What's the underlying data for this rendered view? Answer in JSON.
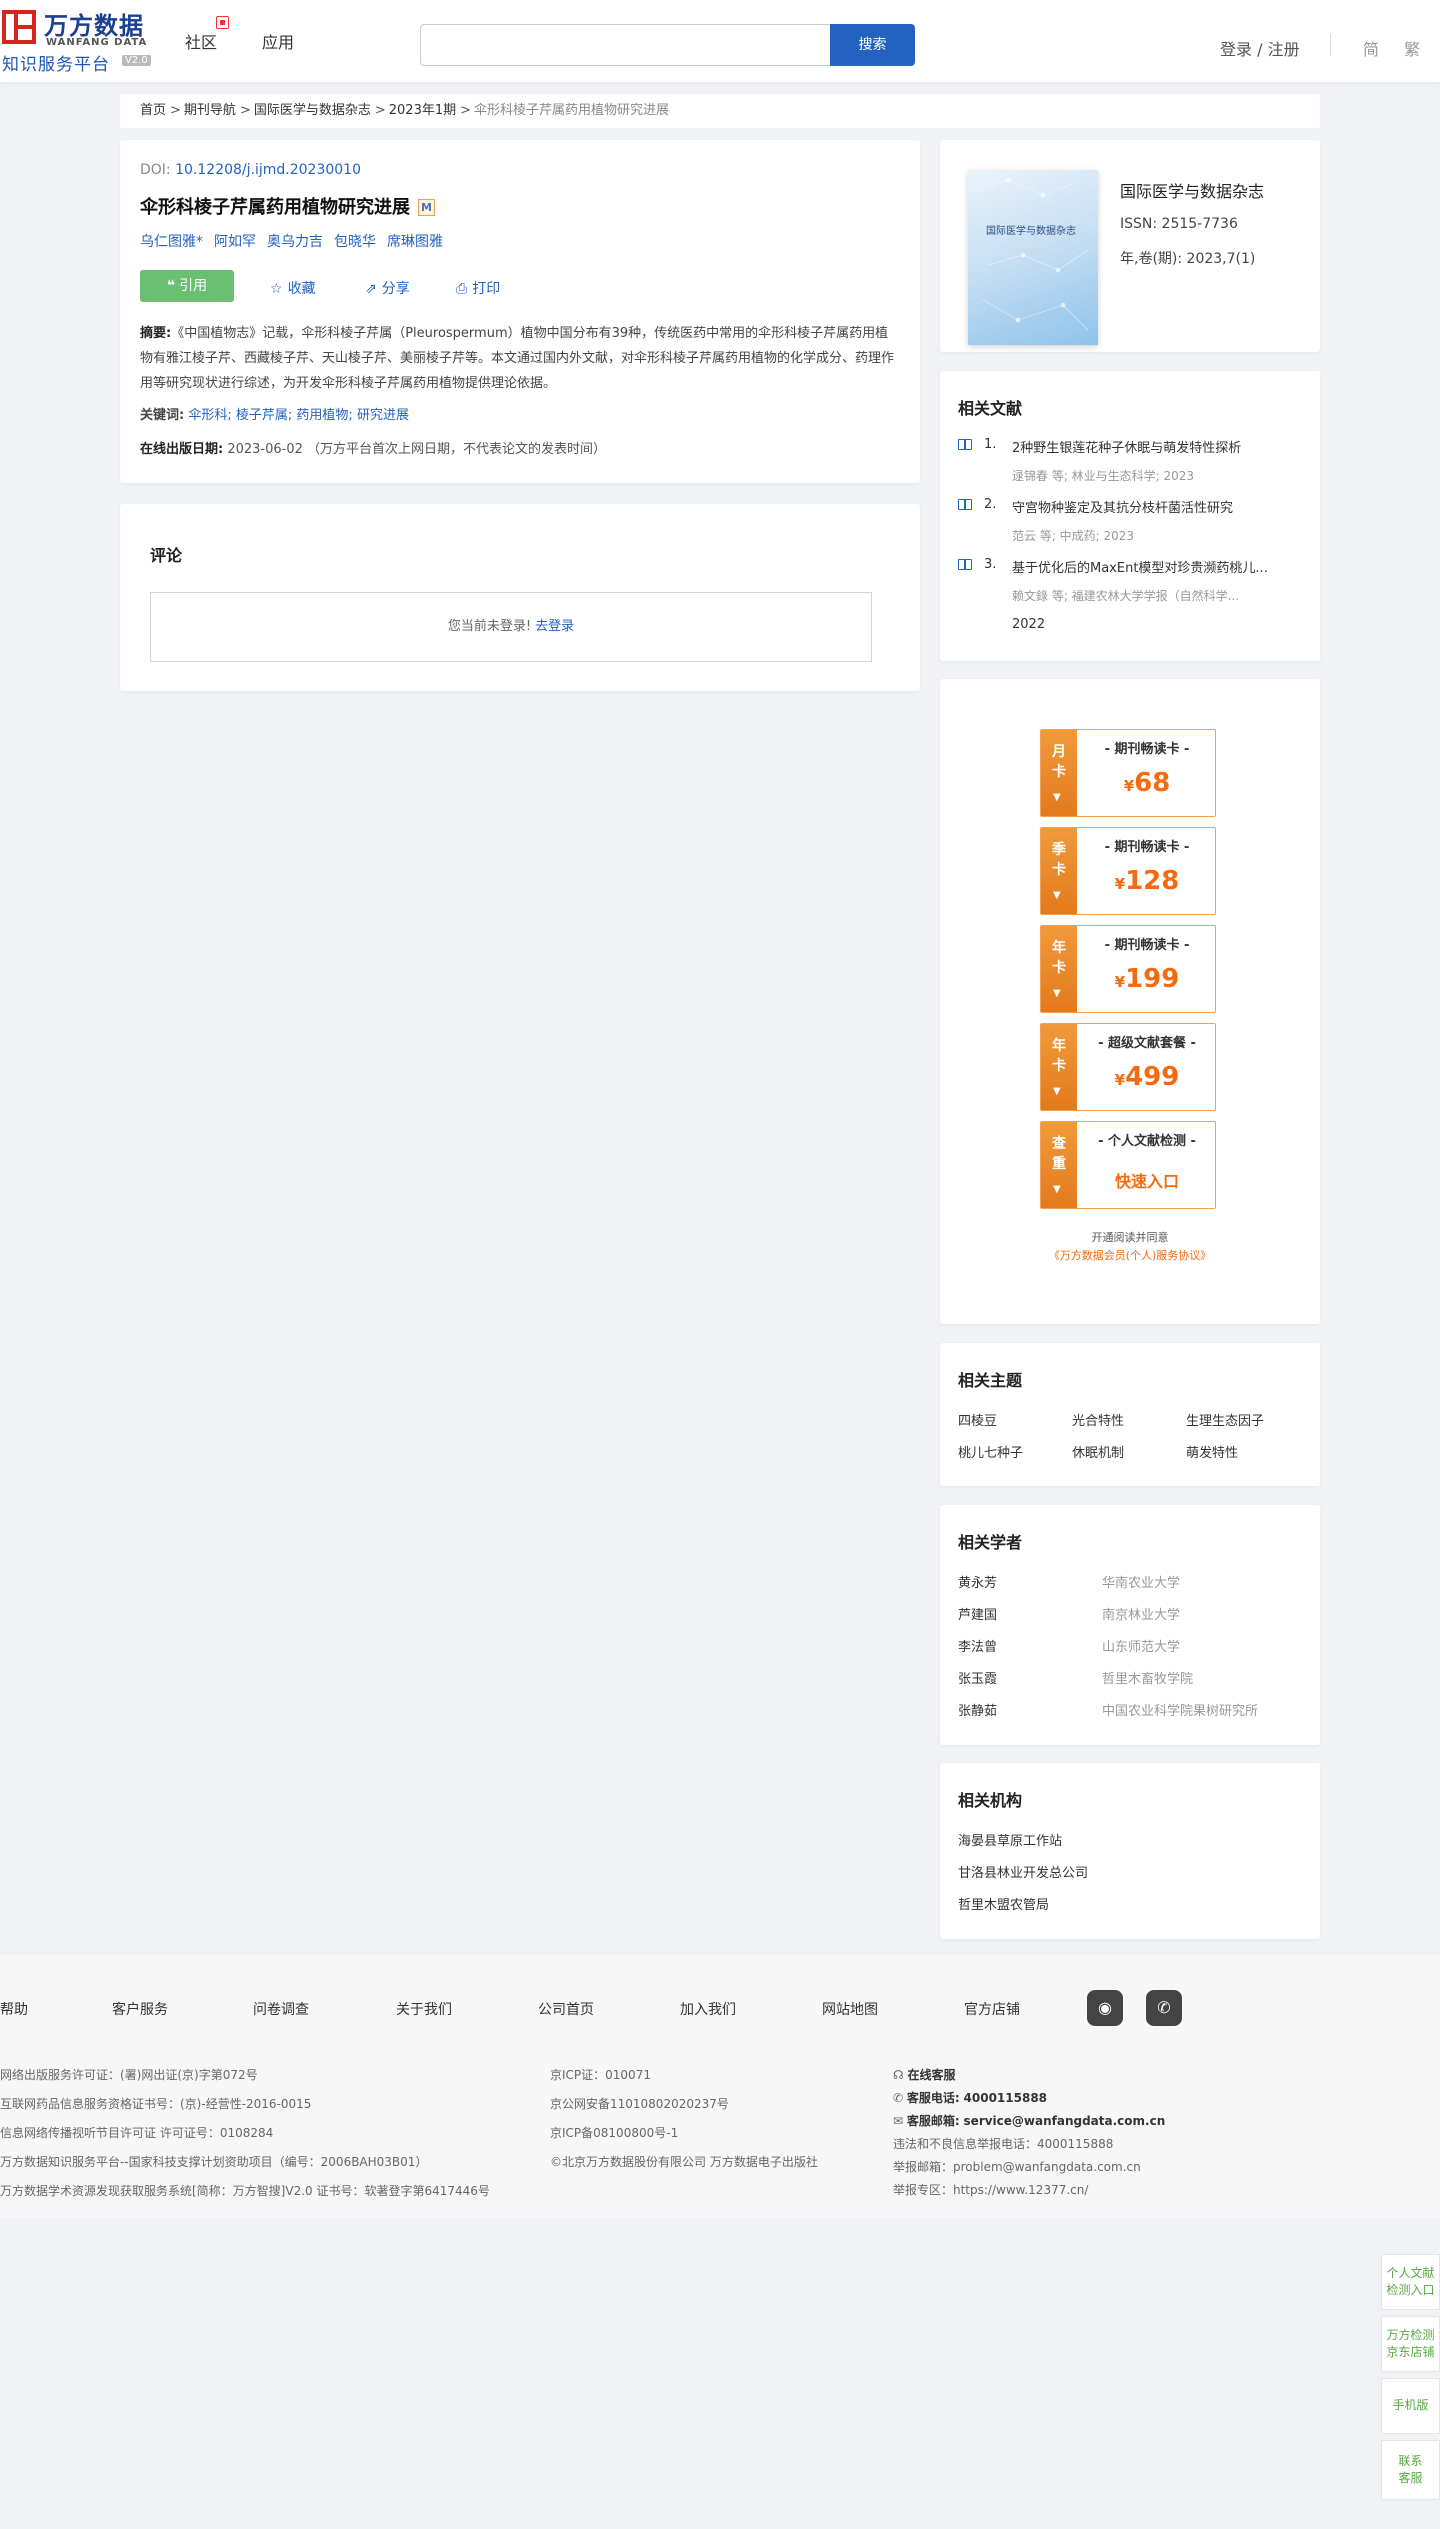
{
  "header": {
    "logo_cn": "万方数据",
    "logo_en": "WANFANG DATA",
    "logo_sub": "知识服务平台",
    "logo_ver": "V2.0",
    "nav": [
      "社区",
      "应用"
    ],
    "search_placeholder": "",
    "search_btn": "搜索",
    "login": "登录 / 注册",
    "lang_simplified": "简",
    "lang_traditional": "繁"
  },
  "breadcrumb": [
    "首页",
    "期刊导航",
    "国际医学与数据杂志",
    "2023年1期",
    "伞形科棱子芹属药用植物研究进展"
  ],
  "article": {
    "doi_label": "DOI:",
    "doi": "10.12208/j.ijmd.20230010",
    "title": "伞形科棱子芹属药用植物研究进展",
    "m_badge": "M",
    "authors": [
      "乌仁图雅*",
      "阿如罕",
      "奥乌力吉",
      "包晓华",
      "席琳图雅"
    ],
    "cite": "引用",
    "actions": [
      {
        "icon": "☆",
        "label": "收藏"
      },
      {
        "icon": "⇗",
        "label": "分享"
      },
      {
        "icon": "⎙",
        "label": "打印"
      }
    ],
    "abstract_label": "摘要:",
    "abstract": "《中国植物志》记载，伞形科棱子芹属（Pleurospermum）植物中国分布有39种，传统医药中常用的伞形科棱子芹属药用植物有雅江棱子芹、西藏棱子芹、天山棱子芹、美丽棱子芹等。本文通过国内外文献，对伞形科棱子芹属药用植物的化学成分、药理作用等研究现状进行综述，为开发伞形科棱子芹属药用植物提供理论依据。",
    "keywords_label": "关键词:",
    "keywords": [
      "伞形科;",
      "棱子芹属;",
      "药用植物;",
      "研究进展"
    ],
    "pubdate_label": "在线出版日期:",
    "pubdate": "2023-06-02",
    "pubdate_note": "（万方平台首次上网日期，不代表论文的发表时间）"
  },
  "comments": {
    "title": "评论",
    "not_logged": "您当前未登录!",
    "go_login": "去登录"
  },
  "journal": {
    "cover_text": "国际医学与数据杂志",
    "name": "国际医学与数据杂志",
    "issn": "ISSN:  2515-7736",
    "year_vol": "年,卷(期):  2023,7(1)"
  },
  "related_docs": {
    "title": "相关文献",
    "items": [
      {
        "num": "1.",
        "title": "2种野生银莲花种子休眠与萌发特性探析",
        "meta": "逯锦春  等;  林业与生态科学;  2023",
        "year": ""
      },
      {
        "num": "2.",
        "title": "守宫物种鉴定及其抗分枝杆菌活性研究",
        "meta": "范云  等;  中成药;  2023",
        "year": ""
      },
      {
        "num": "3.",
        "title": "基于优化后的MaxEnt模型对珍贵濒药桃儿...",
        "meta": "赖文錄  等;  福建农林大学学报（自然科学...",
        "year": "2022"
      }
    ]
  },
  "promo": {
    "cards": [
      {
        "side": [
          "月",
          "卡"
        ],
        "head": "- 期刊畅读卡 -",
        "currency": "¥",
        "price": "68"
      },
      {
        "side": [
          "季",
          "卡"
        ],
        "head": "- 期刊畅读卡 -",
        "currency": "¥",
        "price": "128"
      },
      {
        "side": [
          "年",
          "卡"
        ],
        "head": "- 期刊畅读卡 -",
        "currency": "¥",
        "price": "199"
      },
      {
        "side": [
          "年",
          "卡"
        ],
        "head": "- 超级文献套餐 -",
        "currency": "¥",
        "price": "499"
      },
      {
        "side": [
          "查",
          "重"
        ],
        "head": "- 个人文献检测 -",
        "quick": "快速入口"
      }
    ],
    "note1": "开通阅读并同意",
    "note2": "《万方数据会员(个人)服务协议》"
  },
  "topics": {
    "title": "相关主题",
    "items": [
      "四棱豆",
      "光合特性",
      "生理生态因子",
      "桃儿七种子",
      "休眠机制",
      "萌发特性"
    ]
  },
  "scholars": {
    "title": "相关学者",
    "items": [
      {
        "name": "黄永芳",
        "aff": "华南农业大学"
      },
      {
        "name": "芦建国",
        "aff": "南京林业大学"
      },
      {
        "name": "李法曾",
        "aff": "山东师范大学"
      },
      {
        "name": "张玉霞",
        "aff": "哲里木畜牧学院"
      },
      {
        "name": "张静茹",
        "aff": "中国农业科学院果树研究所"
      }
    ]
  },
  "orgs": {
    "title": "相关机构",
    "items": [
      "海晏县草原工作站",
      "甘洛县林业开发总公司",
      "哲里木盟农管局"
    ]
  },
  "footer": {
    "nav": [
      "帮助",
      "客户服务",
      "问卷调查",
      "关于我们",
      "公司首页",
      "加入我们",
      "网站地图",
      "官方店铺"
    ],
    "col1": [
      "网络出版服务许可证：(署)网出证(京)字第072号",
      "互联网药品信息服务资格证书号：(京)-经营性-2016-0015",
      "信息网络传播视听节目许可证 许可证号：0108284",
      "万方数据知识服务平台--国家科技支撑计划资助项目（编号：2006BAH03B01）",
      "万方数据学术资源发现获取服务系统[简称：万方智搜]V2.0 证书号：软著登字第6417446号"
    ],
    "col2": [
      "京ICP证：010071",
      "京公网安备11010802020237号",
      "京ICP备08100800号-1",
      "©北京万方数据股份有限公司 万方数据电子出版社"
    ],
    "online_service": "在线客服",
    "phone_label": "客服电话:",
    "phone": "4000115888",
    "email_label": "客服邮箱:",
    "email": "service@wanfangdata.com.cn",
    "report_phone": "违法和不良信息举报电话：4000115888",
    "report_email": "举报邮箱：problem@wanfangdata.com.cn",
    "report_zone": "举报专区：https://www.12377.cn/"
  },
  "float": [
    {
      "line1": "个人文献",
      "line2": "检测入口"
    },
    {
      "line1": "万方检测",
      "line2": "京东店铺"
    },
    {
      "line1": "手机版",
      "line2": ""
    },
    {
      "line1": "联系",
      "line2": "客服"
    }
  ]
}
